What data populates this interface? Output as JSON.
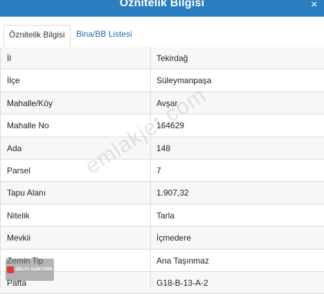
{
  "window": {
    "title": "Öznitelik Bilgisi",
    "close_glyph": "×"
  },
  "tabs": [
    {
      "label": "Öznitelik Bilgisi",
      "active": true
    },
    {
      "label": "Bina/BB Listesi",
      "active": false
    }
  ],
  "rows": [
    {
      "label": "İl",
      "value": "Tekirdağ"
    },
    {
      "label": "İlçe",
      "value": "Süleymanpaşa"
    },
    {
      "label": "Mahalle/Köy",
      "value": "Avşar"
    },
    {
      "label": "Mahalle No",
      "value": "164629"
    },
    {
      "label": "Ada",
      "value": "148"
    },
    {
      "label": "Parsel",
      "value": "7"
    },
    {
      "label": "Tapu Alanı",
      "value": "1.907,32"
    },
    {
      "label": "Nitelik",
      "value": "Tarla"
    },
    {
      "label": "Mevkii",
      "value": "İçmedere"
    },
    {
      "label": "Zemin Tip",
      "value": "Ana Taşınmaz"
    },
    {
      "label": "Pafta",
      "value": "G18-B-13-A-2"
    }
  ],
  "watermark": {
    "text": "emlakjet.com"
  },
  "logo": {
    "text": "DELTA GÖKTÜRK"
  },
  "colors": {
    "titlebar": "#2a7dc0",
    "link": "#2a6aa8"
  }
}
